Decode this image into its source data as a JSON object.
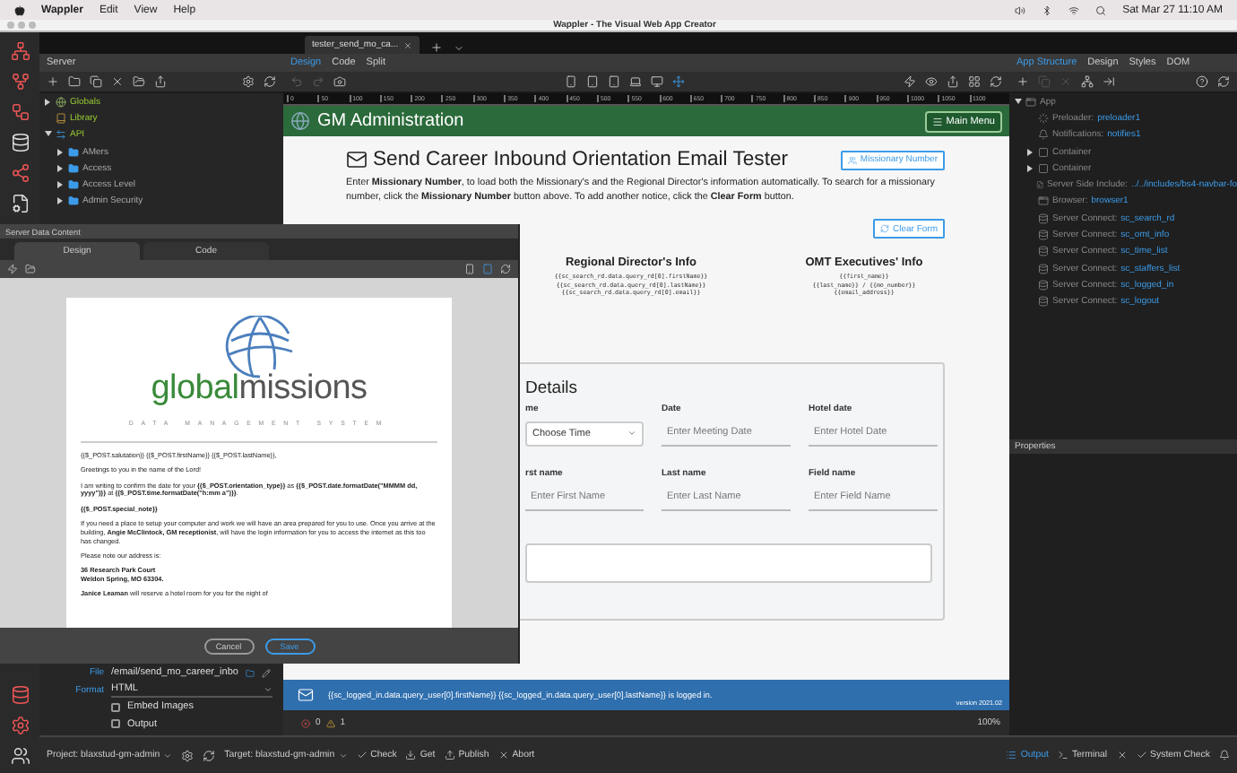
{
  "menubar": {
    "app": "Wappler",
    "menus": [
      "Edit",
      "View",
      "Help"
    ],
    "clock": "Sat Mar 27  11:10 AM"
  },
  "window": {
    "title": "Wappler - The Visual Web App Creator"
  },
  "doc_tabs": [
    {
      "label": "tester_send_mo_ca...",
      "selected": true
    }
  ],
  "server_panel": {
    "title": "Server",
    "tree": [
      {
        "label": "Globals",
        "kind": "globe",
        "expanded": false
      },
      {
        "label": "Library",
        "kind": "book"
      },
      {
        "label": "API",
        "kind": "api",
        "expanded": true,
        "children": [
          {
            "label": "AMers",
            "kind": "folder",
            "expanded": false
          },
          {
            "label": "Access",
            "kind": "folder",
            "expanded": false
          },
          {
            "label": "Access Level",
            "kind": "folder",
            "expanded": false
          },
          {
            "label": "Admin Security",
            "kind": "folder",
            "expanded": false
          }
        ]
      }
    ]
  },
  "view_tabs": [
    {
      "label": "Design",
      "selected": true
    },
    {
      "label": "Code",
      "selected": false
    },
    {
      "label": "Split",
      "selected": false
    }
  ],
  "ruler": [
    "0",
    "50",
    "100",
    "150",
    "200",
    "250",
    "300",
    "350",
    "400",
    "450",
    "500",
    "550",
    "600",
    "650",
    "700",
    "750",
    "800",
    "850",
    "900",
    "950",
    "1000",
    "1050",
    "1100"
  ],
  "page": {
    "brand": "GM Administration",
    "menu_button": "Main Menu",
    "heading": "Send Career Inbound Orientation Email Tester",
    "missionary_button": "Missionary Number",
    "intro": "Enter **Missionary Number**, to load both the Missionary's and the Regional Director's information automatically. To search for a missionary number, click the **Missionary Number** button above. To add another notice, click the **Clear Form** button.",
    "clear_button": "Clear Form",
    "info_columns": [
      {
        "title": "Regional Director's Info",
        "lines": [
          "{{sc_search_rd.data.query_rd[0].firstName}}",
          "{{sc_search_rd.data.query_rd[0].lastName}}",
          "{{sc_search_rd.data.query_rd[0].email}}"
        ]
      },
      {
        "title": "OMT Executives' Info",
        "lines": [
          "{{first_name}}",
          "{{last_name}} / {{mo_number}}",
          "{{email_address}}"
        ]
      }
    ],
    "details": {
      "title": "Details",
      "fields": [
        {
          "label": "me",
          "kind": "select",
          "value": "Choose Time"
        },
        {
          "label": "Date",
          "kind": "input",
          "placeholder": "Enter Meeting Date"
        },
        {
          "label": "Hotel date",
          "kind": "input",
          "placeholder": "Enter Hotel Date"
        },
        {
          "label": "rst name",
          "kind": "input",
          "placeholder": "Enter First Name"
        },
        {
          "label": "Last name",
          "kind": "input",
          "placeholder": "Enter Last Name"
        },
        {
          "label": "Field name",
          "kind": "input",
          "placeholder": "Enter Field Name"
        }
      ]
    }
  },
  "notification": {
    "message": "{{sc_logged_in.data.query_user[0].firstName}} {{sc_logged_in.data.query_user[0].lastName}} is logged in.",
    "version": "version 2021.02"
  },
  "problems": {
    "errors": "0",
    "warnings": "1",
    "zoom": "100%"
  },
  "structure_tabs": [
    {
      "label": "App Structure",
      "selected": true
    },
    {
      "label": "Design",
      "selected": false
    },
    {
      "label": "Styles",
      "selected": false
    },
    {
      "label": "DOM",
      "selected": false
    }
  ],
  "structure_tree": [
    {
      "label": "App",
      "kind": "app",
      "expanded": true,
      "children": [
        {
          "label": "Preloader:",
          "value": "preloader1",
          "kind": "preloader"
        },
        {
          "label": "Notifications:",
          "value": "notifies1",
          "kind": "notify"
        },
        {
          "label": "Container",
          "kind": "container",
          "expanded": false
        },
        {
          "label": "Container",
          "kind": "container",
          "expanded": false
        },
        {
          "label": "Server Side Include:",
          "value": "../../includes/bs4-navbar-fo",
          "kind": "include"
        },
        {
          "label": "Browser:",
          "value": "browser1",
          "kind": "browser"
        },
        {
          "label": "Server Connect:",
          "value": "sc_search_rd",
          "kind": "connect"
        },
        {
          "label": "Server Connect:",
          "value": "sc_omt_info",
          "kind": "connect"
        },
        {
          "label": "Server Connect:",
          "value": "sc_time_list",
          "kind": "connect"
        },
        {
          "label": "Server Connect:",
          "value": "sc_staffers_list",
          "kind": "connect"
        },
        {
          "label": "Server Connect:",
          "value": "sc_logged_in",
          "kind": "connect"
        },
        {
          "label": "Server Connect:",
          "value": "sc_logout",
          "kind": "connect"
        }
      ]
    }
  ],
  "properties_title": "Properties",
  "dialog": {
    "title": "Server Data Content",
    "tabs": [
      {
        "label": "Design",
        "selected": true
      },
      {
        "label": "Code",
        "selected": false
      }
    ],
    "logo": {
      "first": "global",
      "second": "missions",
      "tagline": "DATA MANAGEMENT SYSTEM"
    },
    "paragraphs": [
      {
        "kind": "text",
        "lines": [
          "{{$_POST.salutation}} {{$_POST.firstName}} {{$_POST.lastName}},"
        ]
      },
      {
        "kind": "text",
        "lines": [
          "Greetings to you in the name of the Lord!"
        ]
      },
      {
        "kind": "text",
        "lines": [
          "I am writing to confirm the date for your **{{$_POST.orientation_type}}** as **{{$_POST.date.formatDate(\"MMMM dd, yyyy\")}}** at **{{$_POST.time.formatDate(\"h:mm a\")}}**."
        ]
      },
      {
        "kind": "strong",
        "lines": [
          "{{$_POST.special_note}}"
        ]
      },
      {
        "kind": "text",
        "lines": [
          "If you need a place to setup your computer and work we will have an area prepared for you to use. Once you arrive at the building, **Angie McClintock, GM receptionist**, will have the login information for you to access the internet as this too has changed."
        ]
      },
      {
        "kind": "text",
        "lines": [
          "Please note our address is:"
        ]
      },
      {
        "kind": "strong",
        "lines": [
          "36 Research Park Court",
          "Weldon Spring, MO 63304."
        ]
      },
      {
        "kind": "text",
        "lines": [
          "**Janice Leaman** will reserve a hotel room for you for the night of"
        ]
      }
    ],
    "cancel": "Cancel",
    "save": "Save"
  },
  "file_props": {
    "file_label": "File",
    "file_value": "/email/send_mo_career_inbo",
    "format_label": "Format",
    "format_value": "HTML",
    "options": [
      {
        "label": "Embed Images",
        "checked": false
      },
      {
        "label": "Output",
        "checked": false
      }
    ]
  },
  "status_bar": {
    "project_label": "Project:",
    "project": "blaxstud-gm-admin",
    "target_label": "Target:",
    "target": "blaxstud-gm-admin",
    "actions": [
      "Check",
      "Get",
      "Publish",
      "Abort"
    ],
    "output": "Output",
    "terminal": "Terminal",
    "system_check": "System Check"
  }
}
